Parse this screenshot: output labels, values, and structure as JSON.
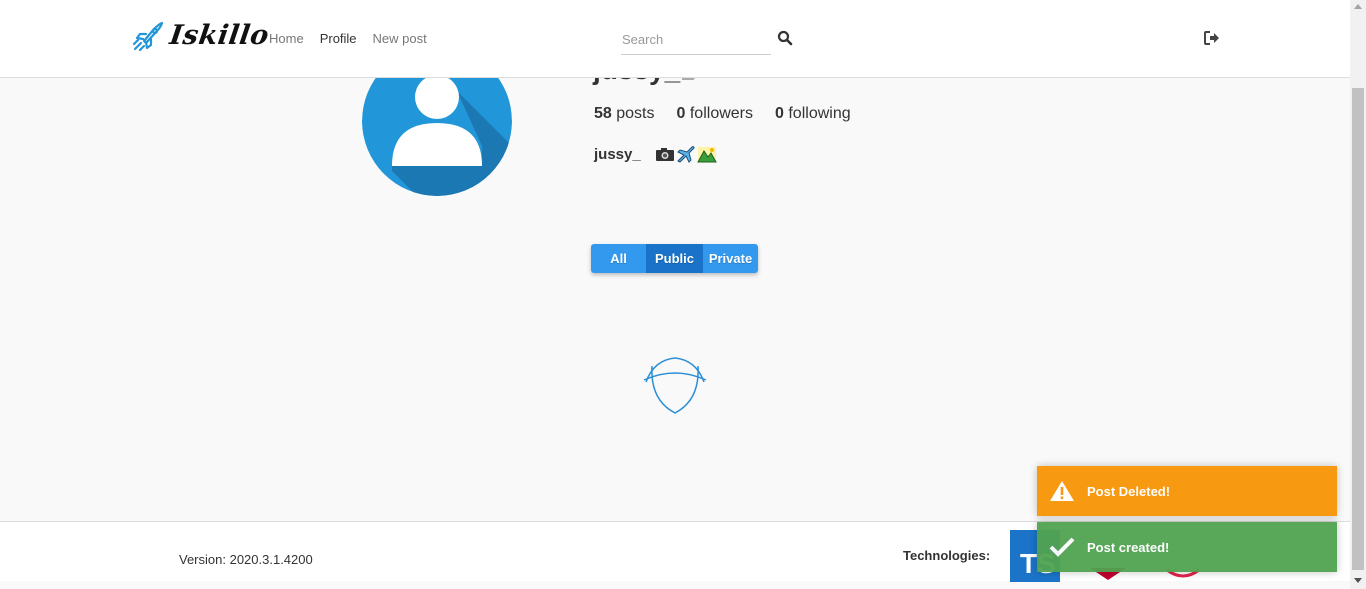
{
  "brand": {
    "name": "Iskillo",
    "logo_icon": "rocket-icon"
  },
  "nav": {
    "home": "Home",
    "profile": "Profile",
    "new_post": "New post"
  },
  "search": {
    "placeholder": "Search",
    "icon": "search-icon"
  },
  "logout": {
    "icon": "sign-out-icon"
  },
  "profile": {
    "username": "jussy_",
    "posts_count": "58",
    "posts_label": "posts",
    "followers_count": "0",
    "followers_label": "followers",
    "following_count": "0",
    "following_label": "following",
    "bio_name": "jussy_",
    "bio_icons": [
      "camera-icon",
      "airplane-icon",
      "mountain-icon"
    ]
  },
  "filters": {
    "all": "All",
    "public": "Public",
    "private": "Private",
    "active": "Public"
  },
  "footer": {
    "version": "Version: 2020.3.1.4200",
    "technologies_label": "Technologies:",
    "ts_logo_text": "TS"
  },
  "toasts": [
    {
      "type": "warning",
      "text": "Post Deleted!",
      "color": "#f89406"
    },
    {
      "type": "success",
      "text": "Post created!",
      "color": "#51a351"
    }
  ],
  "colors": {
    "accent": "#3399ee",
    "active_filter": "#1a73c8",
    "avatar": "#2196d9"
  }
}
